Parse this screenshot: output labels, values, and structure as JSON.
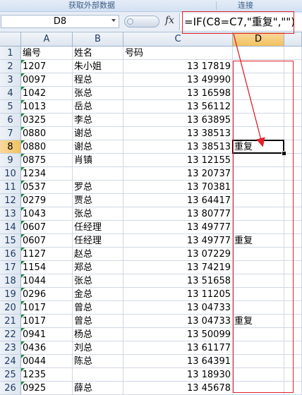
{
  "ribbon": {
    "groups": [
      {
        "label": "获取外部数据"
      },
      {
        "label": "连接"
      }
    ]
  },
  "formula_bar": {
    "name_box": "D8",
    "fx_label": "fx",
    "formula": "=IF(C8=C7,\"重复\",\"\")"
  },
  "columns": [
    "A",
    "B",
    "C",
    "D"
  ],
  "active_column": "D",
  "active_row": "8",
  "rows": [
    {
      "num": "1",
      "a": "编号",
      "b": "姓名",
      "c": "号码",
      "d": "",
      "header": true
    },
    {
      "num": "2",
      "a": "1207",
      "b": "朱小姐",
      "c": "13      17819",
      "d": ""
    },
    {
      "num": "3",
      "a": "0097",
      "b": "程总",
      "c": "13      49990",
      "d": ""
    },
    {
      "num": "4",
      "a": "1042",
      "b": "张总",
      "c": "13      16598",
      "d": ""
    },
    {
      "num": "5",
      "a": "1013",
      "b": "岳总",
      "c": "13      56112",
      "d": ""
    },
    {
      "num": "6",
      "a": "0325",
      "b": "李总",
      "c": "13      63895",
      "d": ""
    },
    {
      "num": "7",
      "a": "0880",
      "b": "谢总",
      "c": "13      38513",
      "d": ""
    },
    {
      "num": "8",
      "a": "0880",
      "b": "谢总",
      "c": "13      38513",
      "d": "重复"
    },
    {
      "num": "9",
      "a": "0875",
      "b": "肖镇",
      "c": "13      12155",
      "d": ""
    },
    {
      "num": "10",
      "a": "1234",
      "b": "",
      "c": "13      20737",
      "d": ""
    },
    {
      "num": "11",
      "a": "0537",
      "b": "罗总",
      "c": "13      70381",
      "d": ""
    },
    {
      "num": "12",
      "a": "0279",
      "b": "贾总",
      "c": "13      64417",
      "d": ""
    },
    {
      "num": "13",
      "a": "1043",
      "b": "张总",
      "c": "13      80777",
      "d": ""
    },
    {
      "num": "14",
      "a": "0607",
      "b": "任经理",
      "c": "13      49777",
      "d": ""
    },
    {
      "num": "15",
      "a": "0607",
      "b": "任经理",
      "c": "13      49777",
      "d": "重复"
    },
    {
      "num": "16",
      "a": "1127",
      "b": "赵总",
      "c": "13      07229",
      "d": ""
    },
    {
      "num": "17",
      "a": "1154",
      "b": "郑总",
      "c": "13      74219",
      "d": ""
    },
    {
      "num": "18",
      "a": "1044",
      "b": "张总",
      "c": "13      51658",
      "d": ""
    },
    {
      "num": "19",
      "a": "0296",
      "b": "金总",
      "c": "13      11205",
      "d": ""
    },
    {
      "num": "20",
      "a": "1017",
      "b": "曾总",
      "c": "13      04733",
      "d": ""
    },
    {
      "num": "21",
      "a": "1017",
      "b": "曾总",
      "c": "13      04733",
      "d": "重复"
    },
    {
      "num": "22",
      "a": "0941",
      "b": "杨总",
      "c": "13      50099",
      "d": ""
    },
    {
      "num": "23",
      "a": "0436",
      "b": "刘总",
      "c": "13      61177",
      "d": ""
    },
    {
      "num": "24",
      "a": "0044",
      "b": "陈总",
      "c": "13      64391",
      "d": ""
    },
    {
      "num": "25",
      "a": "1235",
      "b": "",
      "c": "13      18930",
      "d": ""
    },
    {
      "num": "26",
      "a": "0925",
      "b": "薛总",
      "c": "13      45678",
      "d": ""
    }
  ],
  "colors": {
    "annotation_red": "#e0212b",
    "text_marker_green": "#1f8a3d"
  }
}
